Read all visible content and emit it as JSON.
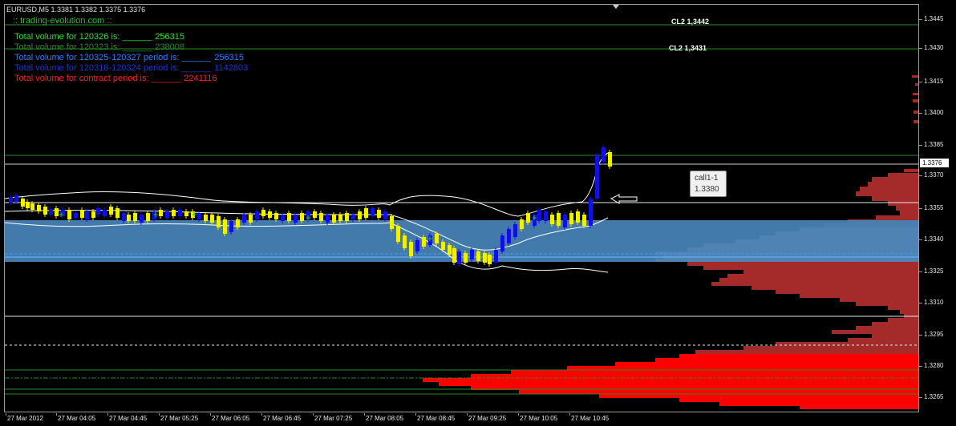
{
  "symbol_header": "EURUSD,M5  1.3381 1.3382 1.3375 1.3376",
  "watermark": ":: trading-evolution.com ::",
  "volumes": [
    {
      "label": "Total volume for 120326 is: ______",
      "value": "256315",
      "color": "#2ee02e"
    },
    {
      "label": "Total volume for 120323 is: ______",
      "value": "238008",
      "color": "#2a8a2a"
    },
    {
      "label": "Total volume for 120325-120327 period is: ______",
      "value": "256315",
      "color": "#2d7fff"
    },
    {
      "label": "Total volume for 120318-120324 period is: ______",
      "value": "1142803",
      "color": "#1a36d8"
    },
    {
      "label": "Total volume for contract period is: ______",
      "value": "2241116",
      "color": "#ff2020"
    }
  ],
  "levels": [
    {
      "text": "CL2 1,3442"
    },
    {
      "text": "CL2 1,3431"
    }
  ],
  "callout": {
    "title": "call1-1",
    "price": "1.3380"
  },
  "current_price": "1.3376",
  "price_axis": [
    "1.3445",
    "1.3430",
    "1.3415",
    "1.3400",
    "1.3385",
    "1.3370",
    "1.3355",
    "1.3340",
    "1.3325",
    "1.3310",
    "1.3295",
    "1.3280",
    "1.3265"
  ],
  "time_axis": [
    "27 Mar 2012",
    "27 Mar 04:05",
    "27 Mar 04:45",
    "27 Mar 05:25",
    "27 Mar 06:05",
    "27 Mar 06:45",
    "27 Mar 07:25",
    "27 Mar 08:05",
    "27 Mar 08:45",
    "27 Mar 09:25",
    "27 Mar 10:05",
    "27 Mar 10:45"
  ],
  "colors": {
    "bull_candle": "#1010e0",
    "bear_candle": "#f0f000",
    "zone_fill": "#4682b4",
    "profile_dark": "#a52a2a",
    "profile_light": "#e8a0a0",
    "profile_red": "#ff0000"
  }
}
